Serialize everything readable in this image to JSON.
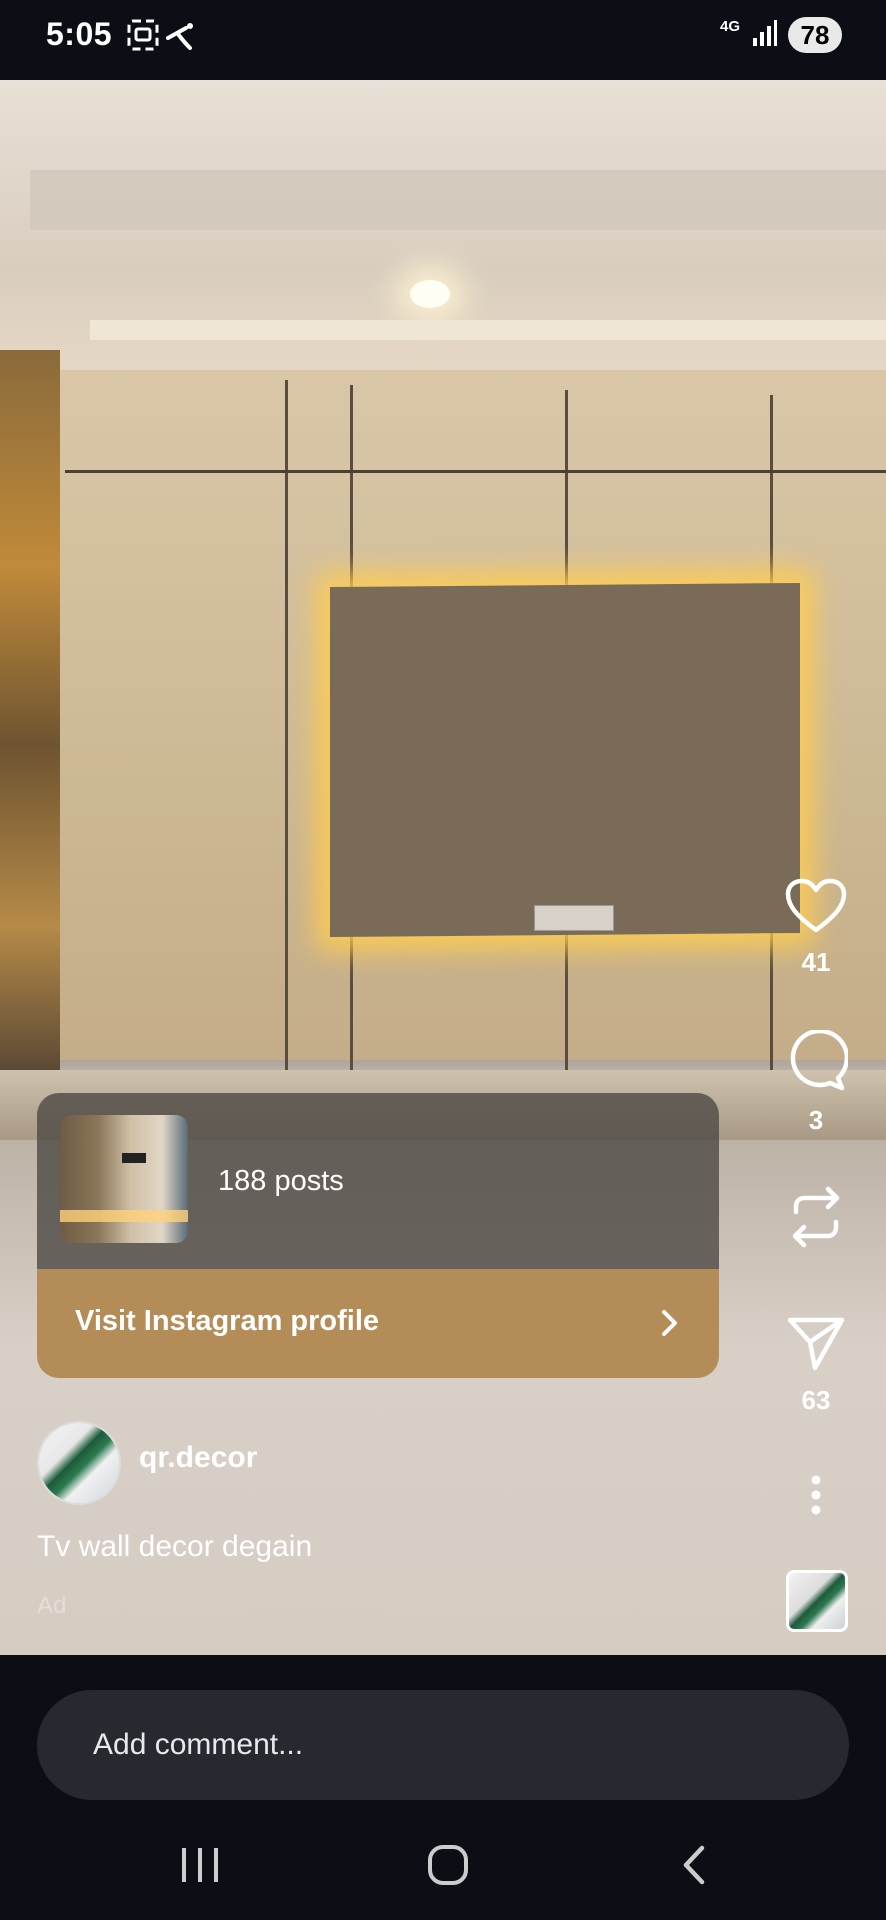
{
  "status_bar": {
    "time": "5:05",
    "network": "4G",
    "battery": "78",
    "icons": [
      "screenshot-icon",
      "carrier-icon",
      "signal-icon",
      "battery-icon"
    ]
  },
  "profile_card": {
    "posts": "188 posts",
    "visit_label": "Visit Instagram profile"
  },
  "post": {
    "author": "qr.decor",
    "caption": "Tv wall decor degain",
    "ad_label": "Ad"
  },
  "actions": {
    "likes": "41",
    "comments": "3",
    "shares": "63"
  },
  "comment": {
    "placeholder": "Add comment..."
  },
  "colors": {
    "background": "#0b0e14",
    "visit_button": "#b48c58",
    "comment_field": "#262930"
  }
}
